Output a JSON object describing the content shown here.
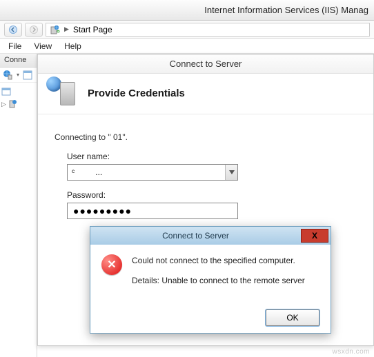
{
  "window": {
    "title": "Internet Information Services (IIS) Manag"
  },
  "addressbar": {
    "path": "Start Page",
    "sep": "▶"
  },
  "menu": {
    "file": "File",
    "view": "View",
    "help": "Help"
  },
  "connections": {
    "header": "Conne"
  },
  "wizard": {
    "title": "Connect to Server",
    "heading": "Provide Credentials",
    "connecting_line": "Connecting to \"            01\".",
    "username_label": "User name:",
    "username_value": "ᶜ         ...",
    "password_label": "Password:",
    "password_masked": "●●●●●●●●●"
  },
  "dialog": {
    "title": "Connect to Server",
    "line1": "Could not connect to the specified computer.",
    "line2": "Details: Unable to connect to the remote server",
    "ok": "OK",
    "close_glyph": "X"
  },
  "watermark": "wsxdn.com"
}
